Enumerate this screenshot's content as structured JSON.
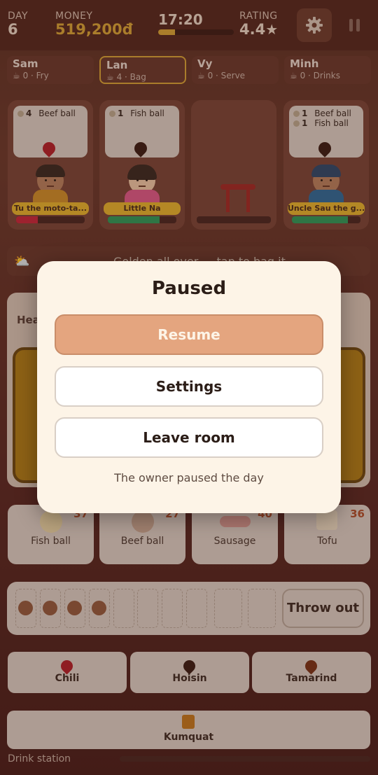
{
  "hud": {
    "day_label": "DAY",
    "day_value": "6",
    "money_label": "MONEY",
    "money_value": "519,200đ",
    "time_value": "17:20",
    "time_progress": 0.22,
    "rating_label": "RATING",
    "rating_value": "4.4",
    "star_glyph": "★"
  },
  "players": [
    {
      "name": "Sam",
      "info": "☕ 0 · Fry"
    },
    {
      "name": "Lan",
      "info": "☕ 4 · Bag"
    },
    {
      "name": "Vy",
      "info": "☕ 0 · Serve"
    },
    {
      "name": "Minh",
      "info": "☕ 0 · Drinks"
    }
  ],
  "customers": [
    {
      "orders": [
        {
          "qty": "4",
          "item": "Beef ball"
        }
      ],
      "sauce_color": "#b3202a",
      "name": "Tu the moto-ta...",
      "patience": 0.32,
      "patience_color": "#c8283c",
      "shirt_color": "#cf8f2a"
    },
    {
      "orders": [
        {
          "qty": "1",
          "item": "Fish ball"
        }
      ],
      "sauce_color": "#3b1e15",
      "name": "Little Na",
      "patience": 0.75,
      "patience_color": "#2f9a5a",
      "shirt_color": "#e05a8a"
    },
    {
      "orders": [
        {
          "qty": "1",
          "item": "Beef ball"
        },
        {
          "qty": "1",
          "item": "Fish ball"
        }
      ],
      "sauce_color": "#3b1e15",
      "name": "Uncle Sau the g...",
      "patience": 0.82,
      "patience_color": "#2f9a5a",
      "shirt_color": "#2f6b9a"
    }
  ],
  "banner": {
    "text": "Golden all over — tap to bag it"
  },
  "cook": {
    "heading": "Hea"
  },
  "ingredients": [
    {
      "name": "Fish ball",
      "count": "37"
    },
    {
      "name": "Beef ball",
      "count": "27"
    },
    {
      "name": "Sausage",
      "count": "40"
    },
    {
      "name": "Tofu",
      "count": "36"
    }
  ],
  "bag": {
    "filled": 4,
    "total": 10,
    "throw_label": "Throw out"
  },
  "sauces": [
    {
      "name": "Chili",
      "color": "#b3202a"
    },
    {
      "name": "Hoisin",
      "color": "#3b1e15"
    },
    {
      "name": "Tamarind",
      "color": "#7a3418"
    }
  ],
  "drink": {
    "name": "Kumquat",
    "station_label": "Drink station"
  },
  "modal": {
    "title": "Paused",
    "resume_label": "Resume",
    "settings_label": "Settings",
    "leave_label": "Leave room",
    "note": "The owner paused the day"
  }
}
